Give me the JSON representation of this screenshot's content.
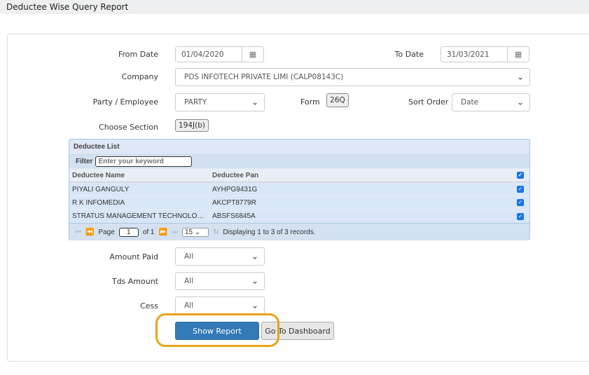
{
  "title": "Deductee Wise Query Report",
  "from_date": {
    "label": "From Date",
    "value": "01/04/2020"
  },
  "to_date": {
    "label": "To Date",
    "value": "31/03/2021"
  },
  "company": {
    "label": "Company",
    "value": "PDS INFOTECH PRIVATE LIMI (CALP08143C)"
  },
  "party": {
    "label": "Party / Employee",
    "value": "PARTY"
  },
  "form": {
    "label": "Form",
    "value": "26Q"
  },
  "sort": {
    "label": "Sort Order",
    "value": "Date"
  },
  "section": {
    "label": "Choose Section",
    "value": "194J(b)"
  },
  "grid": {
    "title": "Deductee List",
    "filter_label": "Filter",
    "filter_placeholder": "Enter your keyword",
    "columns": [
      "Deductee Name",
      "Deductee Pan"
    ],
    "rows": [
      {
        "name": "PIYALI GANGULY",
        "pan": "AYHPG9431G"
      },
      {
        "name": "R K INFOMEDIA",
        "pan": "AKCPT8779R"
      },
      {
        "name": "STRATUS MANAGEMENT TECHNOLOGI...",
        "pan": "ABSFS6845A"
      }
    ],
    "page_label": "Page",
    "page": "1",
    "of_label": "of 1",
    "page_size": "15",
    "status": "Displaying 1 to 3 of 3 records."
  },
  "amount_paid": {
    "label": "Amount Paid",
    "value": "All"
  },
  "tds_amount": {
    "label": "Tds Amount",
    "value": "All"
  },
  "cess": {
    "label": "Cess",
    "value": "All"
  },
  "buttons": {
    "show": "Show Report",
    "dashboard": "Go To Dashboard"
  }
}
